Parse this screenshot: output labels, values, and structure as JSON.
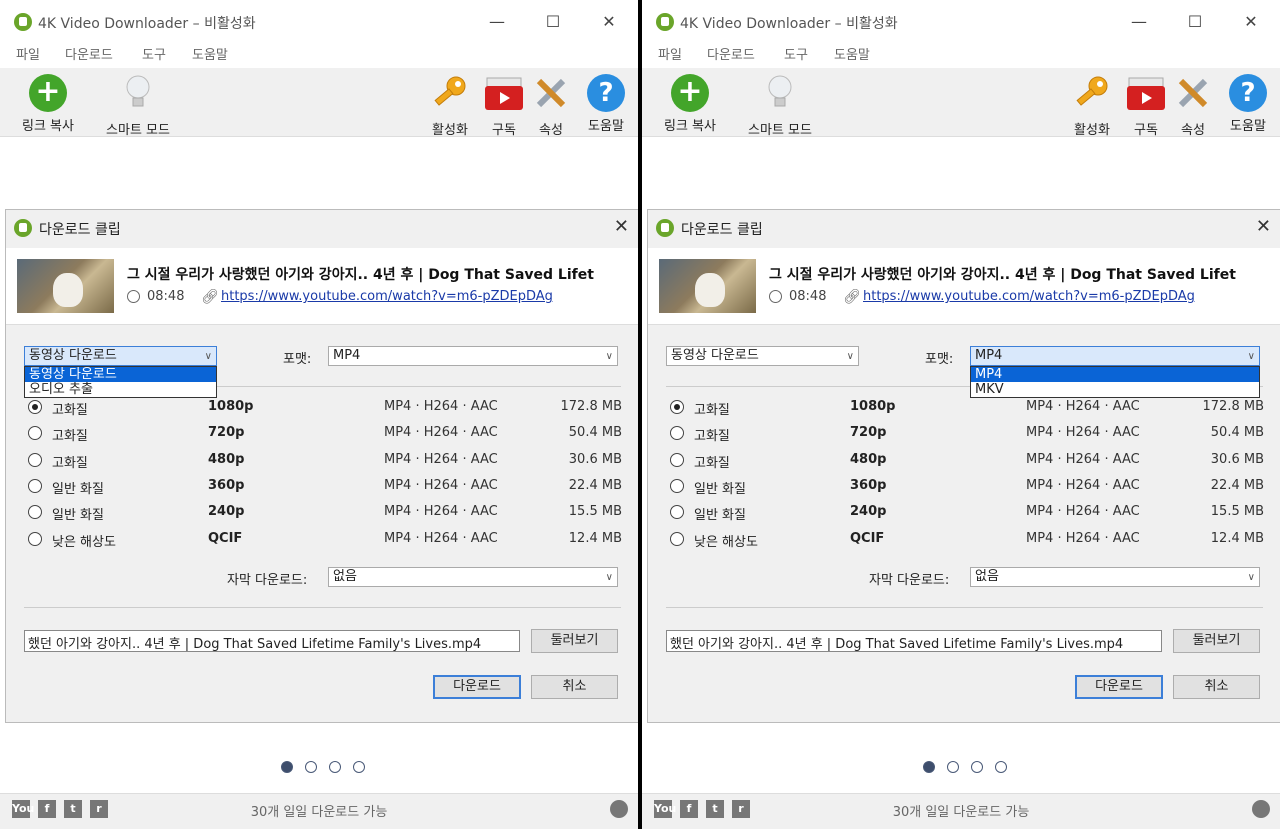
{
  "windows": [
    {
      "title": "4K Video Downloader – 비활성화",
      "menu": [
        "파일",
        "다운로드",
        "도구",
        "도움말"
      ],
      "toolbar": {
        "copy_link": "링크 복사",
        "smart_mode": "스마트 모드",
        "activate": "활성화",
        "subscribe": "구독",
        "settings": "속성",
        "help": "도움말"
      },
      "dialog": {
        "title": "다운로드 클립",
        "video_title": "그 시절 우리가 사랑했던 아기와 강아지.. 4년 후 | Dog That Saved Lifet",
        "duration": "08:48",
        "url": "https://www.youtube.com/watch?v=m6-pZDEpDAg",
        "download_type": "동영상 다운로드",
        "download_type_options": [
          "동영상 다운로드",
          "오디오 추출"
        ],
        "download_type_open": true,
        "format_label": "포맷:",
        "format": "MP4",
        "format_options": [
          "MP4",
          "MKV"
        ],
        "format_open": false,
        "qualities": [
          {
            "name": "고화질",
            "res": "1080p",
            "codec": "MP4 · H264 · AAC",
            "size": "172.8 MB",
            "selected": true
          },
          {
            "name": "고화질",
            "res": "720p",
            "codec": "MP4 · H264 · AAC",
            "size": "50.4 MB",
            "selected": false
          },
          {
            "name": "고화질",
            "res": "480p",
            "codec": "MP4 · H264 · AAC",
            "size": "30.6 MB",
            "selected": false
          },
          {
            "name": "일반 화질",
            "res": "360p",
            "codec": "MP4 · H264 · AAC",
            "size": "22.4 MB",
            "selected": false
          },
          {
            "name": "일반 화질",
            "res": "240p",
            "codec": "MP4 · H264 · AAC",
            "size": "15.5 MB",
            "selected": false
          },
          {
            "name": "낮은 해상도",
            "res": "QCIF",
            "codec": "MP4 · H264 · AAC",
            "size": "12.4 MB",
            "selected": false
          }
        ],
        "subtitle_label": "자막 다운로드:",
        "subtitle": "없음",
        "filename": "했던 아기와 강아지.. 4년 후 | Dog That Saved Lifetime Family's Lives.mp4",
        "browse": "둘러보기",
        "download": "다운로드",
        "cancel": "취소"
      },
      "page_dots": 4,
      "active_dot": 0,
      "social": [
        "You",
        "f",
        "t",
        "r"
      ],
      "status": "30개 일일 다운로드 가능"
    },
    {
      "title": "4K Video Downloader – 비활성화",
      "menu": [
        "파일",
        "다운로드",
        "도구",
        "도움말"
      ],
      "toolbar": {
        "copy_link": "링크 복사",
        "smart_mode": "스마트 모드",
        "activate": "활성화",
        "subscribe": "구독",
        "settings": "속성",
        "help": "도움말"
      },
      "dialog": {
        "title": "다운로드 클립",
        "video_title": "그 시절 우리가 사랑했던 아기와 강아지.. 4년 후 | Dog That Saved Lifet",
        "duration": "08:48",
        "url": "https://www.youtube.com/watch?v=m6-pZDEpDAg",
        "download_type": "동영상 다운로드",
        "download_type_options": [
          "동영상 다운로드",
          "오디오 추출"
        ],
        "download_type_open": false,
        "format_label": "포맷:",
        "format": "MP4",
        "format_options": [
          "MP4",
          "MKV"
        ],
        "format_open": true,
        "qualities": [
          {
            "name": "고화질",
            "res": "1080p",
            "codec": "MP4 · H264 · AAC",
            "size": "172.8 MB",
            "selected": true
          },
          {
            "name": "고화질",
            "res": "720p",
            "codec": "MP4 · H264 · AAC",
            "size": "50.4 MB",
            "selected": false
          },
          {
            "name": "고화질",
            "res": "480p",
            "codec": "MP4 · H264 · AAC",
            "size": "30.6 MB",
            "selected": false
          },
          {
            "name": "일반 화질",
            "res": "360p",
            "codec": "MP4 · H264 · AAC",
            "size": "22.4 MB",
            "selected": false
          },
          {
            "name": "일반 화질",
            "res": "240p",
            "codec": "MP4 · H264 · AAC",
            "size": "15.5 MB",
            "selected": false
          },
          {
            "name": "낮은 해상도",
            "res": "QCIF",
            "codec": "MP4 · H264 · AAC",
            "size": "12.4 MB",
            "selected": false
          }
        ],
        "subtitle_label": "자막 다운로드:",
        "subtitle": "없음",
        "filename": "했던 아기와 강아지.. 4년 후 | Dog That Saved Lifetime Family's Lives.mp4",
        "browse": "둘러보기",
        "download": "다운로드",
        "cancel": "취소"
      },
      "page_dots": 4,
      "active_dot": 0,
      "social": [
        "You",
        "f",
        "t",
        "r"
      ],
      "status": "30개 일일 다운로드 가능"
    }
  ]
}
